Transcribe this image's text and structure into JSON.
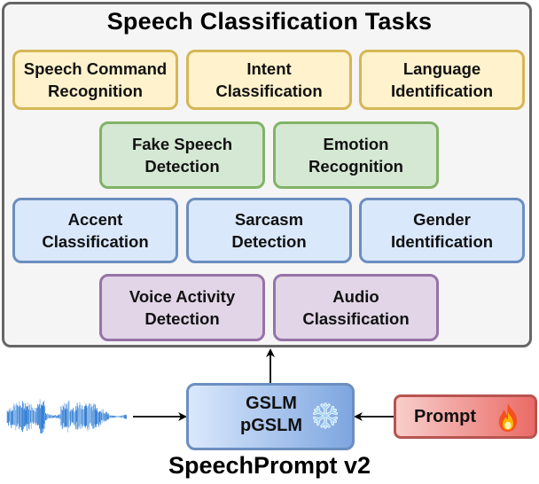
{
  "panel": {
    "title": "Speech Classification Tasks",
    "rows": [
      {
        "color": "yellow",
        "tasks": [
          {
            "label": "Speech Command\nRecognition"
          },
          {
            "label": "Intent\nClassification"
          },
          {
            "label": "Language\nIdentification"
          }
        ]
      },
      {
        "color": "green",
        "tasks": [
          {
            "label": "Fake Speech\nDetection"
          },
          {
            "label": "Emotion\nRecognition"
          }
        ]
      },
      {
        "color": "blue",
        "tasks": [
          {
            "label": "Accent\nClassification"
          },
          {
            "label": "Sarcasm\nDetection"
          },
          {
            "label": "Gender\nIdentification"
          }
        ]
      },
      {
        "color": "purple",
        "tasks": [
          {
            "label": "Voice Activity\nDetection"
          },
          {
            "label": "Audio\nClassification"
          }
        ]
      }
    ]
  },
  "model": {
    "line1": "GSLM",
    "line2": "pGSLM",
    "status_icon": "snowflake-icon",
    "status": "frozen"
  },
  "prompt": {
    "label": "Prompt",
    "status_icon": "fire-icon",
    "status": "trainable"
  },
  "input": {
    "icon": "waveform-icon"
  },
  "caption": "SpeechPrompt v2",
  "colors": {
    "yellow_fill": "#fff2cc",
    "yellow_border": "#d6b656",
    "green_fill": "#d5e8d4",
    "green_border": "#82b366",
    "blue_fill": "#dae8fc",
    "blue_border": "#6c8ebf",
    "purple_fill": "#e1d5e7",
    "purple_border": "#9673a6",
    "prompt_fill": "#f8cecc",
    "prompt_border": "#b85450",
    "waveform": "#1a6fd0"
  }
}
